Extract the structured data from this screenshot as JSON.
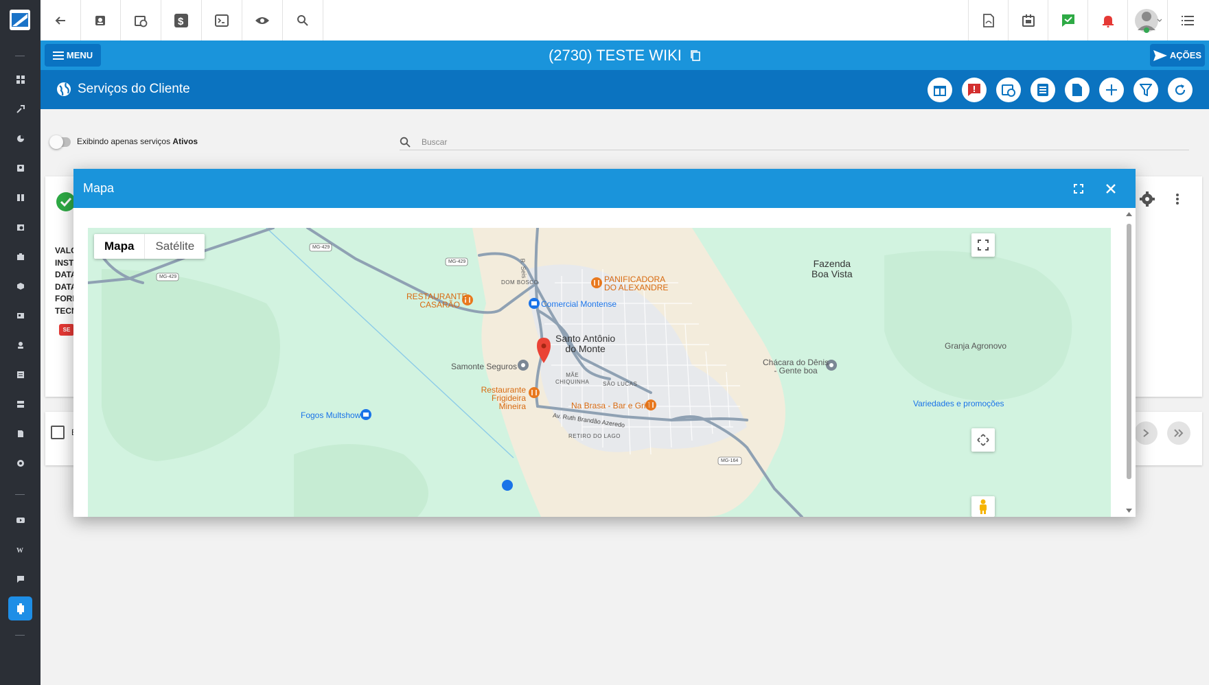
{
  "page": {
    "title": "(2730) TESTE WIKI",
    "menu_label": "MENU",
    "actions_label": "AÇÕES",
    "section_title": "Serviços do Cliente"
  },
  "filter": {
    "toggle_text": "Exibindo apenas serviços ",
    "toggle_bold": "Ativos",
    "search_placeholder": "Buscar"
  },
  "card": {
    "lines": [
      "VALO",
      "INST",
      "DATA",
      "DATA",
      "FORM",
      "TECN"
    ],
    "badge": "SE",
    "row_label": "E"
  },
  "modal": {
    "title": "Mapa"
  },
  "map": {
    "tabs": [
      "Mapa",
      "Satélite"
    ],
    "active_tab": "Mapa",
    "places": {
      "town_line1": "Santo Antônio",
      "town_line2": "do Monte",
      "fazenda_line1": "Fazenda",
      "fazenda_line2": "Boa Vista",
      "panificadora_line1": "PANIFICADORA",
      "panificadora_line2": "DO ALEXANDRE",
      "restaurante_casarao_line1": "RESTAURANTE",
      "restaurante_casarao_line2": "CASARÃO",
      "comercial": "Comercial Montense",
      "dom_bosco": "DOM BOSCO",
      "samonte": "Samonte Seguros",
      "frigideira_line1": "Restaurante",
      "frigideira_line2": "Frigideira Mineira",
      "mae_line1": "MÃE",
      "mae_line2": "CHIQUINHA",
      "sao_lucas": "SÃO LUCAS",
      "na_brasa": "Na Brasa - Bar e Grill",
      "av_ruth": "Av. Ruth Brandão Azeredo",
      "retiro": "RETIRO DO LAGO",
      "fogos": "Fogos Multshow",
      "chacara_line1": "Chácara do Dênis",
      "chacara_line2": "- Gente boa",
      "granja": "Granja Agronovo",
      "variedades": "Variedades e promoções",
      "mg429a": "MG-429",
      "mg429b": "MG-429",
      "mg429c": "MG-429",
      "mg164": "MG-164",
      "r_seis": "R. Seis"
    }
  },
  "colors": {
    "sidebar": "#2b2f36",
    "header_blue": "#1a94db",
    "subheader_blue": "#0b73c0",
    "map_green": "#d2f3e0",
    "poi_orange": "#e8781e",
    "poi_blue": "#1a73e8",
    "pin_red": "#ea4335"
  }
}
